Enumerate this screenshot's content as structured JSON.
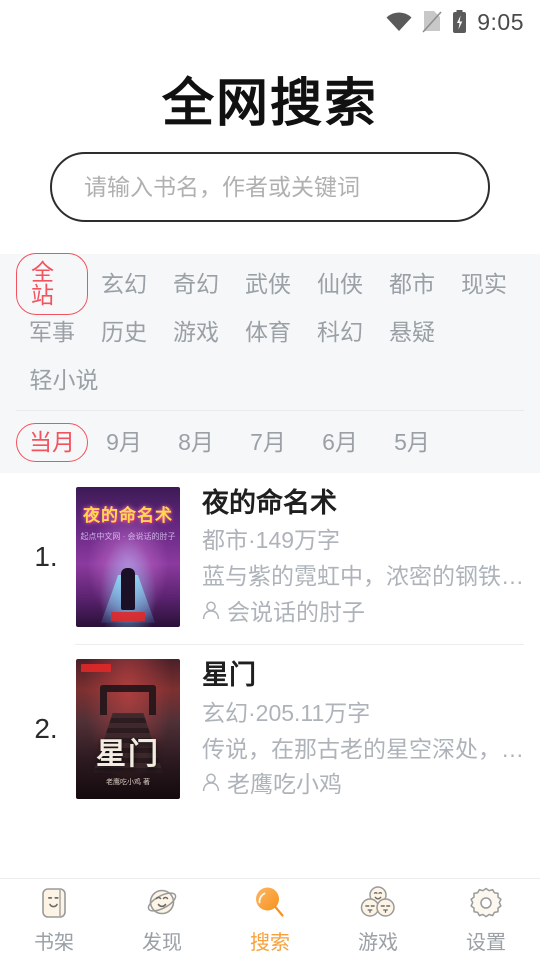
{
  "status_bar": {
    "time": "9:05",
    "icons": [
      "wifi-icon",
      "no-sim-icon",
      "battery-charging-icon"
    ]
  },
  "header": {
    "title": "全网搜索"
  },
  "search": {
    "placeholder": "请输入书名，作者或关键词",
    "value": ""
  },
  "filters": {
    "categories": [
      "全站",
      "玄幻",
      "奇幻",
      "武侠",
      "仙侠",
      "都市",
      "现实",
      "军事",
      "历史",
      "游戏",
      "体育",
      "科幻",
      "悬疑",
      "轻小说"
    ],
    "selected_category": "全站",
    "months": [
      "当月",
      "9月",
      "8月",
      "7月",
      "6月",
      "5月"
    ],
    "selected_month": "当月",
    "accent_color": "#f2535e",
    "inactive_color": "#9aa0a6"
  },
  "books": [
    {
      "rank": "1.",
      "title": "夜的命名术",
      "meta": "都市·149万字",
      "desc": "蓝与紫的霓虹中，浓密的钢铁苍穹…",
      "author": "会说话的肘子",
      "cover_title": "夜的命名术",
      "cover_sub": "起点中文网 · 会说话的肘子"
    },
    {
      "rank": "2.",
      "title": "星门",
      "meta": "玄幻·205.11万字",
      "desc": "传说，在那古老的星空深处，伫立…",
      "author": "老鹰吃小鸡",
      "cover_title": "星门",
      "cover_sub": "老鹰吃小鸡 著"
    }
  ],
  "tabbar": {
    "items": [
      {
        "label": "书架",
        "icon": "bookshelf-face-icon",
        "active": false
      },
      {
        "label": "发现",
        "icon": "planet-face-icon",
        "active": false
      },
      {
        "label": "搜索",
        "icon": "magnifier-icon",
        "active": true
      },
      {
        "label": "游戏",
        "icon": "three-faces-icon",
        "active": false
      },
      {
        "label": "设置",
        "icon": "gear-icon",
        "active": false
      }
    ],
    "active_color": "#f7a13c"
  }
}
